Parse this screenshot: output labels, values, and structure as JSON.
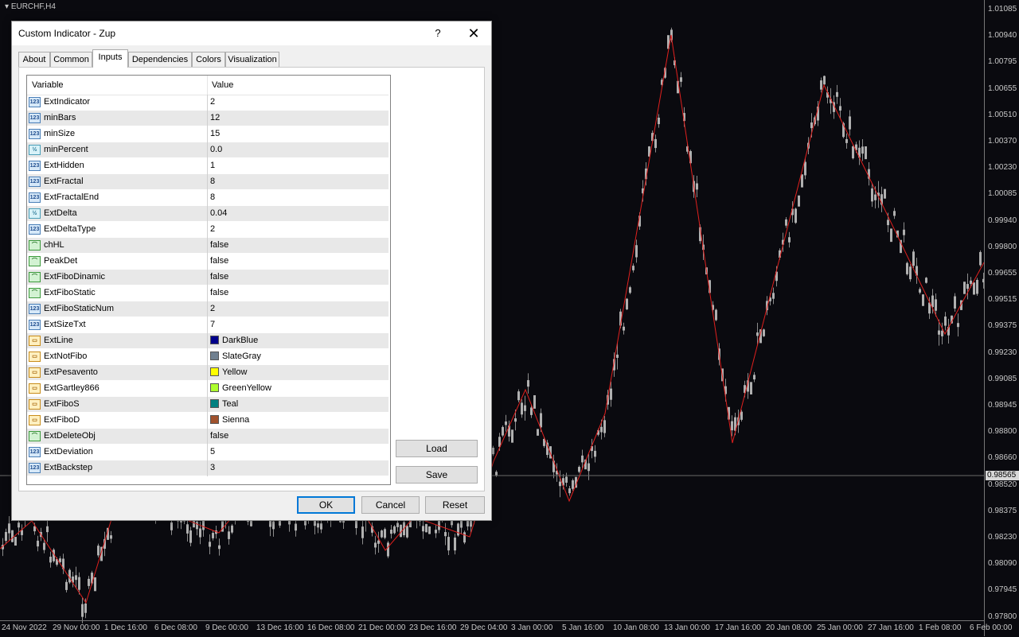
{
  "chart": {
    "symbol_label": "EURCHF,H4",
    "current_price": "0.98565",
    "price_labels": [
      "1.01085",
      "1.00940",
      "1.00795",
      "1.00655",
      "1.00510",
      "1.00370",
      "1.00230",
      "1.00085",
      "0.99940",
      "0.99800",
      "0.99655",
      "0.99515",
      "0.99375",
      "0.99230",
      "0.99085",
      "0.98945",
      "0.98800",
      "0.98660",
      "0.98520",
      "0.98375",
      "0.98230",
      "0.98090",
      "0.97945",
      "0.97800"
    ],
    "time_labels": [
      "24 Nov 2022",
      "29 Nov 00:00",
      "1 Dec 16:00",
      "6 Dec 08:00",
      "9 Dec 00:00",
      "13 Dec 16:00",
      "16 Dec 08:00",
      "21 Dec 00:00",
      "23 Dec 16:00",
      "29 Dec 04:00",
      "3 Jan 00:00",
      "5 Jan 16:00",
      "10 Jan 08:00",
      "13 Jan 00:00",
      "17 Jan 16:00",
      "20 Jan 08:00",
      "25 Jan 00:00",
      "27 Jan 16:00",
      "1 Feb 08:00",
      "6 Feb 00:00"
    ],
    "colors": {
      "background": "#0a0a0f",
      "candles": "#8c8c8c",
      "zigzag": "#e0201e",
      "axis_text": "#c8c8c8"
    }
  },
  "dialog": {
    "title": "Custom Indicator - Zup",
    "help_label": "?",
    "close_label": "✕",
    "tabs": [
      {
        "label": "About"
      },
      {
        "label": "Common"
      },
      {
        "label": "Inputs"
      },
      {
        "label": "Dependencies"
      },
      {
        "label": "Colors"
      },
      {
        "label": "Visualization"
      }
    ],
    "active_tab": "Inputs",
    "grid": {
      "col_variable": "Variable",
      "col_value": "Value",
      "rows": [
        {
          "icon": "int-icon",
          "type": "num",
          "badge": "123",
          "variable": "ExtIndicator",
          "value": "2"
        },
        {
          "icon": "int-icon",
          "type": "num",
          "badge": "123",
          "variable": "minBars",
          "value": "12"
        },
        {
          "icon": "int-icon",
          "type": "num",
          "badge": "123",
          "variable": "minSize",
          "value": "15"
        },
        {
          "icon": "double-icon",
          "type": "dbl",
          "badge": "½",
          "variable": "minPercent",
          "value": "0.0"
        },
        {
          "icon": "int-icon",
          "type": "num",
          "badge": "123",
          "variable": "ExtHidden",
          "value": "1"
        },
        {
          "icon": "int-icon",
          "type": "num",
          "badge": "123",
          "variable": "ExtFractal",
          "value": "8"
        },
        {
          "icon": "int-icon",
          "type": "num",
          "badge": "123",
          "variable": "ExtFractalEnd",
          "value": "8"
        },
        {
          "icon": "double-icon",
          "type": "dbl",
          "badge": "½",
          "variable": "ExtDelta",
          "value": "0.04"
        },
        {
          "icon": "int-icon",
          "type": "num",
          "badge": "123",
          "variable": "ExtDeltaType",
          "value": "2"
        },
        {
          "icon": "bool-icon",
          "type": "bool",
          "badge": "⌒",
          "variable": "chHL",
          "value": "false"
        },
        {
          "icon": "bool-icon",
          "type": "bool",
          "badge": "⌒",
          "variable": "PeakDet",
          "value": "false"
        },
        {
          "icon": "bool-icon",
          "type": "bool",
          "badge": "⌒",
          "variable": "ExtFiboDinamic",
          "value": "false"
        },
        {
          "icon": "bool-icon",
          "type": "bool",
          "badge": "⌒",
          "variable": "ExtFiboStatic",
          "value": "false"
        },
        {
          "icon": "int-icon",
          "type": "num",
          "badge": "123",
          "variable": "ExtFiboStaticNum",
          "value": "2"
        },
        {
          "icon": "int-icon",
          "type": "num",
          "badge": "123",
          "variable": "ExtSizeTxt",
          "value": "7"
        },
        {
          "icon": "color-icon",
          "type": "color",
          "badge": "▭",
          "variable": "ExtLine",
          "value": "DarkBlue",
          "swatch": "#00008b"
        },
        {
          "icon": "color-icon",
          "type": "color",
          "badge": "▭",
          "variable": "ExtNotFibo",
          "value": "SlateGray",
          "swatch": "#708090"
        },
        {
          "icon": "color-icon",
          "type": "color",
          "badge": "▭",
          "variable": "ExtPesavento",
          "value": "Yellow",
          "swatch": "#ffff00"
        },
        {
          "icon": "color-icon",
          "type": "color",
          "badge": "▭",
          "variable": "ExtGartley866",
          "value": "GreenYellow",
          "swatch": "#adff2f"
        },
        {
          "icon": "color-icon",
          "type": "color",
          "badge": "▭",
          "variable": "ExtFiboS",
          "value": "Teal",
          "swatch": "#008080"
        },
        {
          "icon": "color-icon",
          "type": "color",
          "badge": "▭",
          "variable": "ExtFiboD",
          "value": "Sienna",
          "swatch": "#a0522d"
        },
        {
          "icon": "bool-icon",
          "type": "bool",
          "badge": "⌒",
          "variable": "ExtDeleteObj",
          "value": "false"
        },
        {
          "icon": "int-icon",
          "type": "num",
          "badge": "123",
          "variable": "ExtDeviation",
          "value": "5"
        },
        {
          "icon": "int-icon",
          "type": "num",
          "badge": "123",
          "variable": "ExtBackstep",
          "value": "3"
        }
      ]
    },
    "buttons": {
      "load": "Load",
      "save": "Save",
      "ok": "OK",
      "cancel": "Cancel",
      "reset": "Reset"
    }
  }
}
